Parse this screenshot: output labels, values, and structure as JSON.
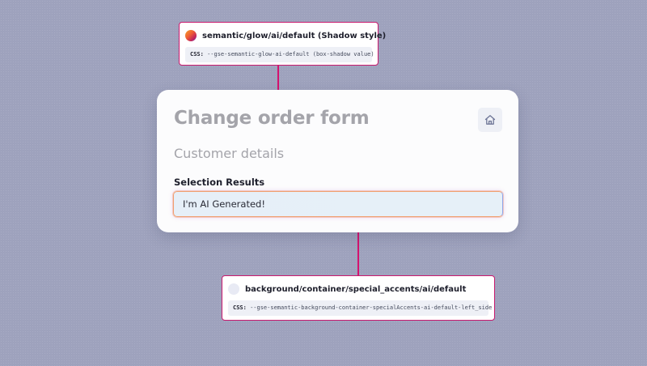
{
  "annotations": {
    "glow": {
      "title": "semantic/glow/ai/default (Shadow style)",
      "css_label": "CSS:",
      "css_value": "--gse-semantic-glow-ai-default (box-shadow value)",
      "swatch_icon": "gradient-glow-swatch"
    },
    "background": {
      "title": "background/container/special_accents/ai/default",
      "css_label": "CSS:",
      "css_value": "--gse-semantic-background-container-specialAccents-ai-default-left_side",
      "swatch_icon": "light-blue-swatch"
    }
  },
  "form": {
    "title": "Change order form",
    "home_icon": "home-icon",
    "section_title": "Customer details",
    "field_label": "Selection Results",
    "field_value": "I'm AI Generated!"
  },
  "colors": {
    "page_background": "#9ea2bd",
    "connector": "#d4126f",
    "annotation_border": "#c91a6e",
    "field_background": "#e6eff8",
    "field_glow_start": "#f0a070",
    "field_glow_end": "#8fa6e8"
  }
}
